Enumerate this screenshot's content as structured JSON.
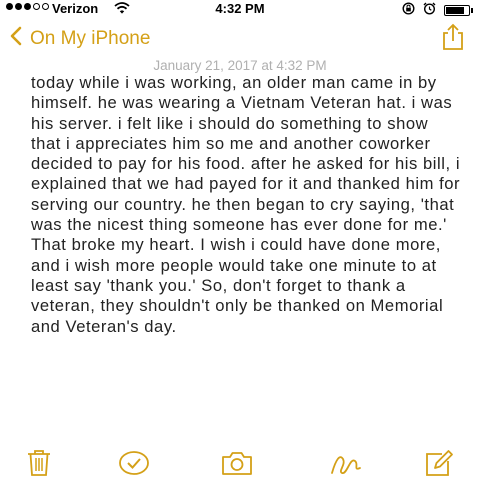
{
  "status_bar": {
    "carrier": "Verizon",
    "time": "4:32 PM",
    "battery_level": 0.9,
    "signal_bars": 3,
    "icons": [
      "signal-dots-icon",
      "wifi-icon",
      "lock-rotation-icon",
      "alarm-icon",
      "battery-icon"
    ]
  },
  "nav": {
    "back_label": "On My iPhone",
    "back_icon": "chevron-left-icon",
    "share_icon": "share-icon"
  },
  "note": {
    "date": "January 21, 2017 at 4:32 PM",
    "body": "today while i was working, an older man came in by himself. he was wearing a Vietnam Veteran hat. i was his server. i felt like i should do something to show that i appreciates him so me and another coworker decided to pay for his food. after he asked for his bill, i explained that we had payed for it and thanked him for serving our country. he then began to cry saying, 'that was the nicest thing someone has ever done for me.' That broke my heart. I wish i could have done more, and i wish more people would take one minute to at least say 'thank you.' So, don't forget to thank a veteran, they shouldn't only be thanked on Memorial and Veteran's day."
  },
  "toolbar": {
    "icons": [
      "trash-icon",
      "checklist-icon",
      "camera-icon",
      "sketch-icon",
      "compose-icon"
    ]
  },
  "colors": {
    "accent": "#d4a017",
    "text": "#222222",
    "date": "#b0b0b0",
    "background": "#ffffff"
  }
}
